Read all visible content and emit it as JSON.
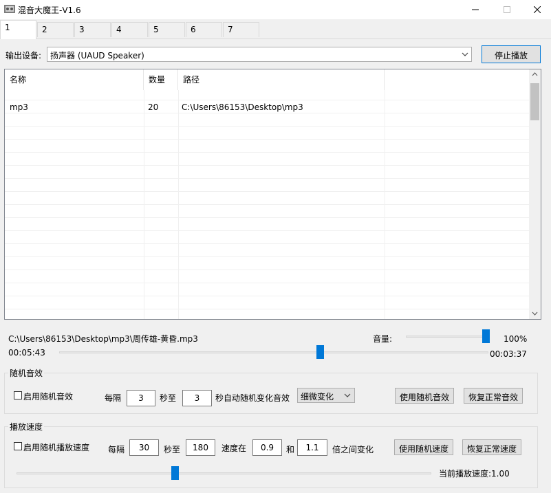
{
  "window": {
    "title": "混音大魔王-V1.6"
  },
  "tabs": [
    "1",
    "2",
    "3",
    "4",
    "5",
    "6",
    "7"
  ],
  "device": {
    "label": "输出设备:",
    "selected": "扬声器 (UAUD Speaker)",
    "stop_button": "停止播放"
  },
  "table": {
    "columns": [
      "名称",
      "数量",
      "路径"
    ],
    "rows": [
      {
        "name": "mp3",
        "count": "20",
        "path": "C:\\Users\\86153\\Desktop\\mp3"
      }
    ]
  },
  "playback": {
    "current_file": "C:\\Users\\86153\\Desktop\\mp3\\周传雄-黄昏.mp3",
    "volume_label": "音量:",
    "volume_percent": "100%",
    "volume_value": 1.0,
    "elapsed": "00:05:43",
    "remaining": "00:03:37",
    "progress": 0.61
  },
  "random_effect": {
    "group_title": "随机音效",
    "enable_label": "启用随机音效",
    "every_label": "每隔",
    "from_value": "3",
    "sec_to_label": "秒至",
    "to_value": "3",
    "suffix_label": "秒自动随机变化音效",
    "mode_selected": "细微变化",
    "use_button": "使用随机音效",
    "restore_button": "恢复正常音效"
  },
  "playback_speed": {
    "group_title": "播放速度",
    "enable_label": "启用随机播放速度",
    "every_label": "每隔",
    "from_value": "30",
    "sec_to_label": "秒至",
    "to_value": "180",
    "speed_in_label": "速度在",
    "min_value": "0.9",
    "and_label": "和",
    "max_value": "1.1",
    "suffix_label": "倍之间变化",
    "use_button": "使用随机速度",
    "restore_button": "恢复正常速度",
    "current_speed_text": "当前播放速度:1.00",
    "slider_position": 0.38
  },
  "colors": {
    "accent": "#0078d7",
    "background": "#f0f0f0"
  }
}
